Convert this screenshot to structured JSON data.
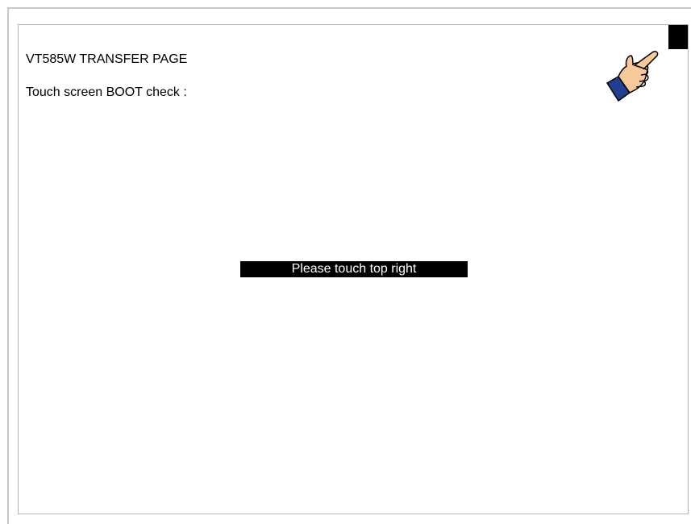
{
  "screen": {
    "title": "VT585W TRANSFER PAGE",
    "subtitle": "Touch screen BOOT check :",
    "prompt": "Please touch top right"
  },
  "icons": {
    "pointer": "pointing-hand-icon",
    "target": "touch-target-square"
  },
  "colors": {
    "background": "#ffffff",
    "text": "#000000",
    "prompt_background": "#000000",
    "prompt_text": "#ffffff",
    "hand_skin": "#f6c99a",
    "hand_cuff": "#1f3f8f"
  }
}
